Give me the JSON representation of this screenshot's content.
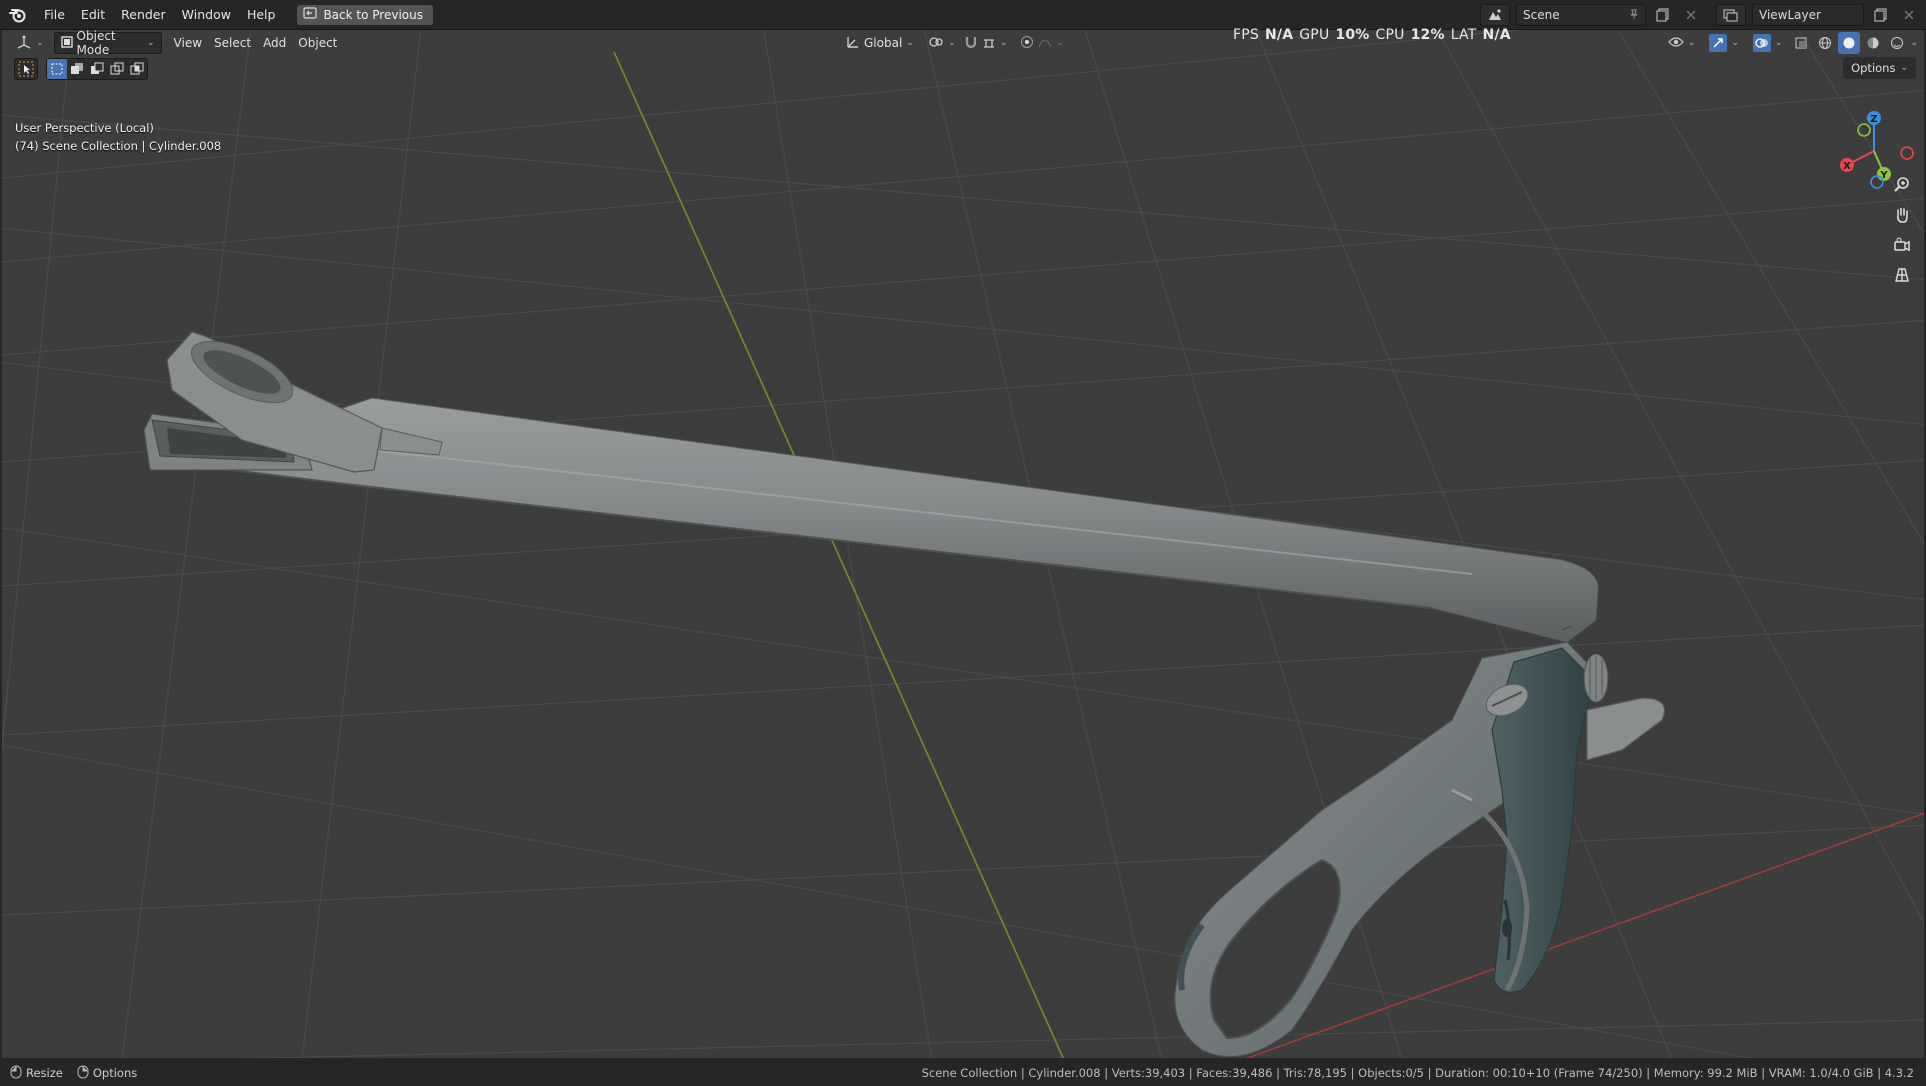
{
  "menubar": {
    "items": [
      "File",
      "Edit",
      "Render",
      "Window",
      "Help"
    ],
    "back_button": "Back to Previous",
    "scene_name": "Scene",
    "view_layer": "ViewLayer"
  },
  "viewport_header": {
    "mode": "Object Mode",
    "menus": [
      "View",
      "Select",
      "Add",
      "Object"
    ],
    "transform_orientation": "Global",
    "options_label": "Options"
  },
  "stats": {
    "fps_label": "FPS",
    "fps_value": "N/A",
    "gpu_label": "GPU",
    "gpu_value": "10%",
    "cpu_label": "CPU",
    "cpu_value": "12%",
    "lat_label": "LAT",
    "lat_value": "N/A"
  },
  "viewport": {
    "perspective": "User Perspective (Local)",
    "collection_info": "(74) Scene Collection | Cylinder.008",
    "gizmo_axes": [
      "X",
      "Y",
      "Z"
    ],
    "background": "#3d3d3d",
    "object_color": "#7b7f80"
  },
  "statusbar": {
    "left_items": [
      "Resize",
      "Options"
    ],
    "right_text": "Scene Collection | Cylinder.008 | Verts:39,403 | Faces:39,486 | Tris:78,195 | Objects:0/5 | Duration: 00:10+10 (Frame 74/250) | Memory: 99.2 MiB | VRAM: 1.0/4.0 GiB | 4.3.2"
  },
  "colors": {
    "accent": "#4772b3",
    "x_axis": "#e8474d",
    "y_axis": "#8cc63f",
    "z_axis": "#3c8fe0"
  }
}
